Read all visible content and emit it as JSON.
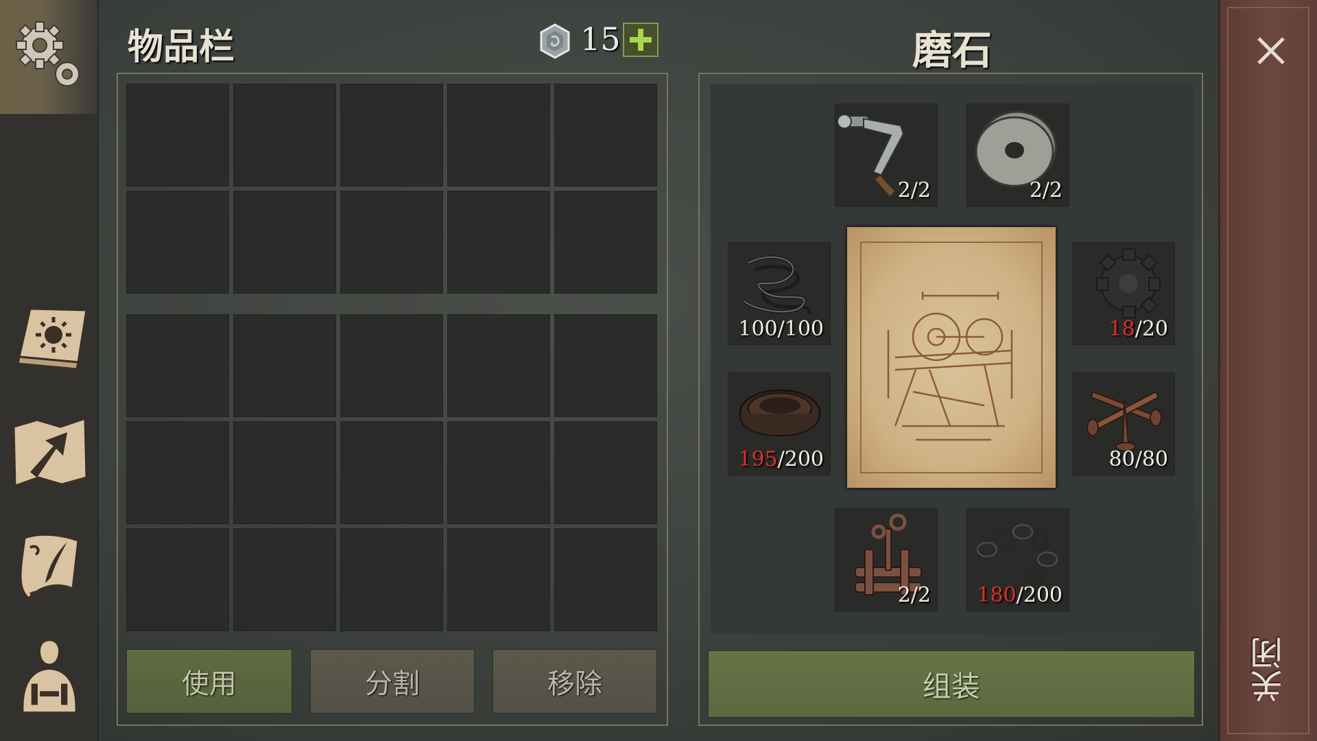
{
  "inventory": {
    "title": "物品栏",
    "currency_count": "15",
    "currency_icon": "silver-coin-icon",
    "plus_icon": "plus-icon",
    "actions": {
      "use": "使用",
      "split": "分割",
      "remove": "移除"
    }
  },
  "sidebar": {
    "icons": [
      "gear-icon",
      "sun-book-icon",
      "map-arrow-icon",
      "quest-scroll-icon",
      "character-icon"
    ]
  },
  "crafting": {
    "title": "磨石",
    "assemble_label": "组装",
    "blueprint_icon": "grindstone-blueprint-icon",
    "components": [
      {
        "icon": "crank-handle-icon",
        "have": "2",
        "need": "2",
        "insufficient": false
      },
      {
        "icon": "stone-wheel-icon",
        "have": "2",
        "need": "2",
        "insufficient": false
      },
      {
        "icon": "wire-coil-icon",
        "have": "100",
        "need": "100",
        "insufficient": false
      },
      {
        "icon": "gear-part-icon",
        "have": "18",
        "need": "20",
        "insufficient": true
      },
      {
        "icon": "leather-strip-icon",
        "have": "195",
        "need": "200",
        "insufficient": true
      },
      {
        "icon": "nails-icon",
        "have": "80",
        "need": "80",
        "insufficient": false
      },
      {
        "icon": "vise-clamp-icon",
        "have": "2",
        "need": "2",
        "insufficient": false
      },
      {
        "icon": "chain-icon",
        "have": "180",
        "need": "200",
        "insufficient": true
      }
    ]
  },
  "close": {
    "label": "关闭",
    "icon": "close-icon"
  },
  "colors": {
    "accent_green": "#5f6b43",
    "insufficient_red": "#d8302a",
    "close_panel": "#6c473e"
  }
}
